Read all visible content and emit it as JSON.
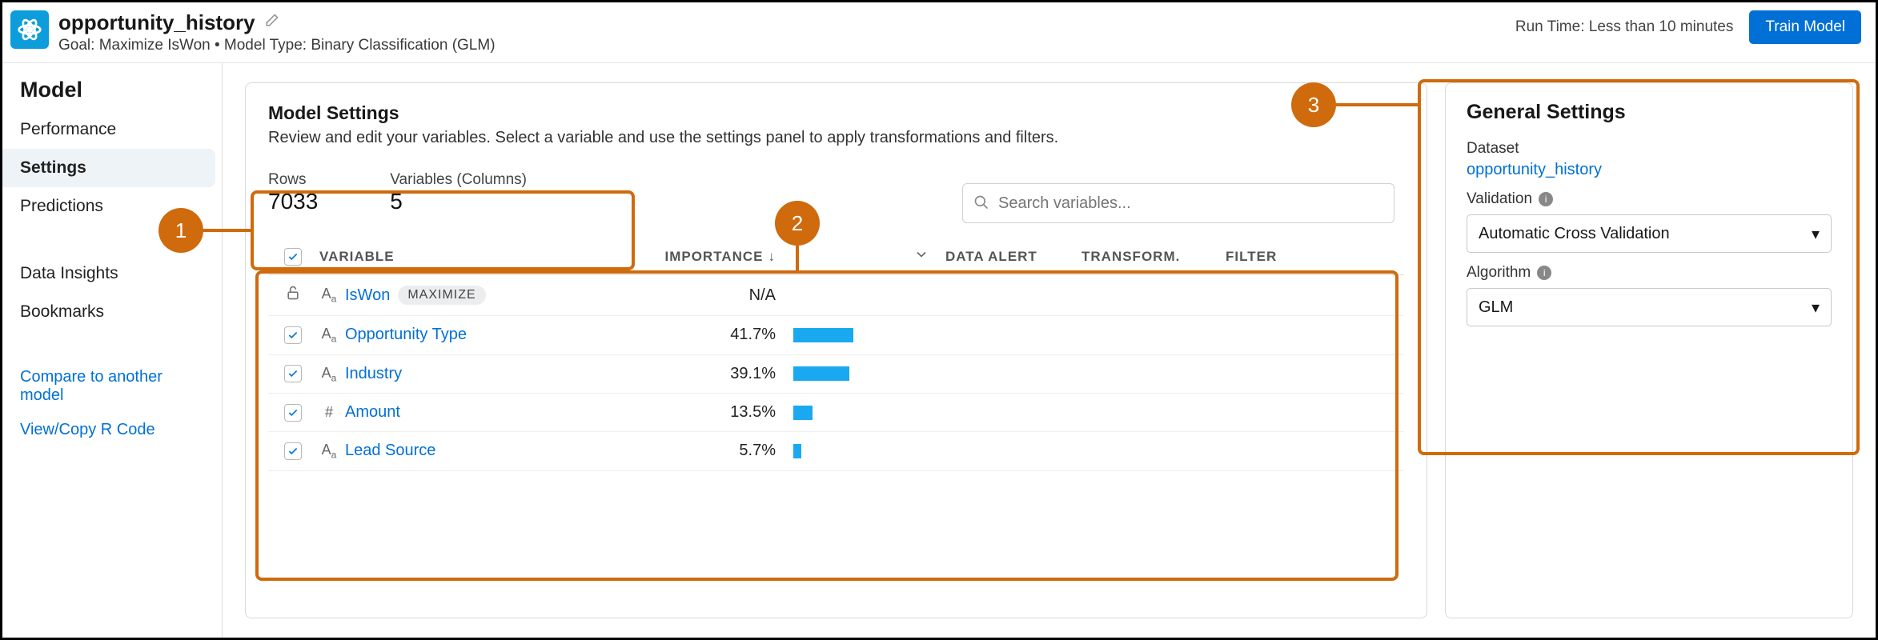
{
  "header": {
    "title": "opportunity_history",
    "subtitle": "Goal: Maximize IsWon • Model Type: Binary Classification (GLM)",
    "runtime": "Run Time: Less than 10 minutes",
    "train_btn": "Train Model"
  },
  "sidebar": {
    "heading": "Model",
    "items": [
      "Performance",
      "Settings",
      "Predictions"
    ],
    "secondary": [
      "Data Insights",
      "Bookmarks"
    ],
    "links": [
      "Compare to another model",
      "View/Copy R Code"
    ]
  },
  "settings": {
    "title": "Model Settings",
    "desc": "Review and edit your variables. Select a variable and use the settings panel to apply transformations and filters.",
    "rows_label": "Rows",
    "rows_value": "7033",
    "vars_label": "Variables (Columns)",
    "vars_value": "5",
    "search_placeholder": "Search variables..."
  },
  "columns": {
    "variable": "VARIABLE",
    "importance": "IMPORTANCE",
    "data_alert": "DATA ALERT",
    "transform": "TRANSFORM.",
    "filter": "FILTER"
  },
  "rows": [
    {
      "name": "IsWon",
      "type": "text",
      "locked": true,
      "badge": "MAXIMIZE",
      "importance": "N/A",
      "bar": 0
    },
    {
      "name": "Opportunity Type",
      "type": "text",
      "locked": false,
      "importance": "41.7%",
      "bar": 41.7
    },
    {
      "name": "Industry",
      "type": "text",
      "locked": false,
      "importance": "39.1%",
      "bar": 39.1
    },
    {
      "name": "Amount",
      "type": "number",
      "locked": false,
      "importance": "13.5%",
      "bar": 13.5
    },
    {
      "name": "Lead Source",
      "type": "text",
      "locked": false,
      "importance": "5.7%",
      "bar": 5.7
    }
  ],
  "general": {
    "title": "General Settings",
    "dataset_label": "Dataset",
    "dataset_value": "opportunity_history",
    "validation_label": "Validation",
    "validation_value": "Automatic Cross Validation",
    "algorithm_label": "Algorithm",
    "algorithm_value": "GLM"
  },
  "callouts": {
    "1": "1",
    "2": "2",
    "3": "3"
  }
}
